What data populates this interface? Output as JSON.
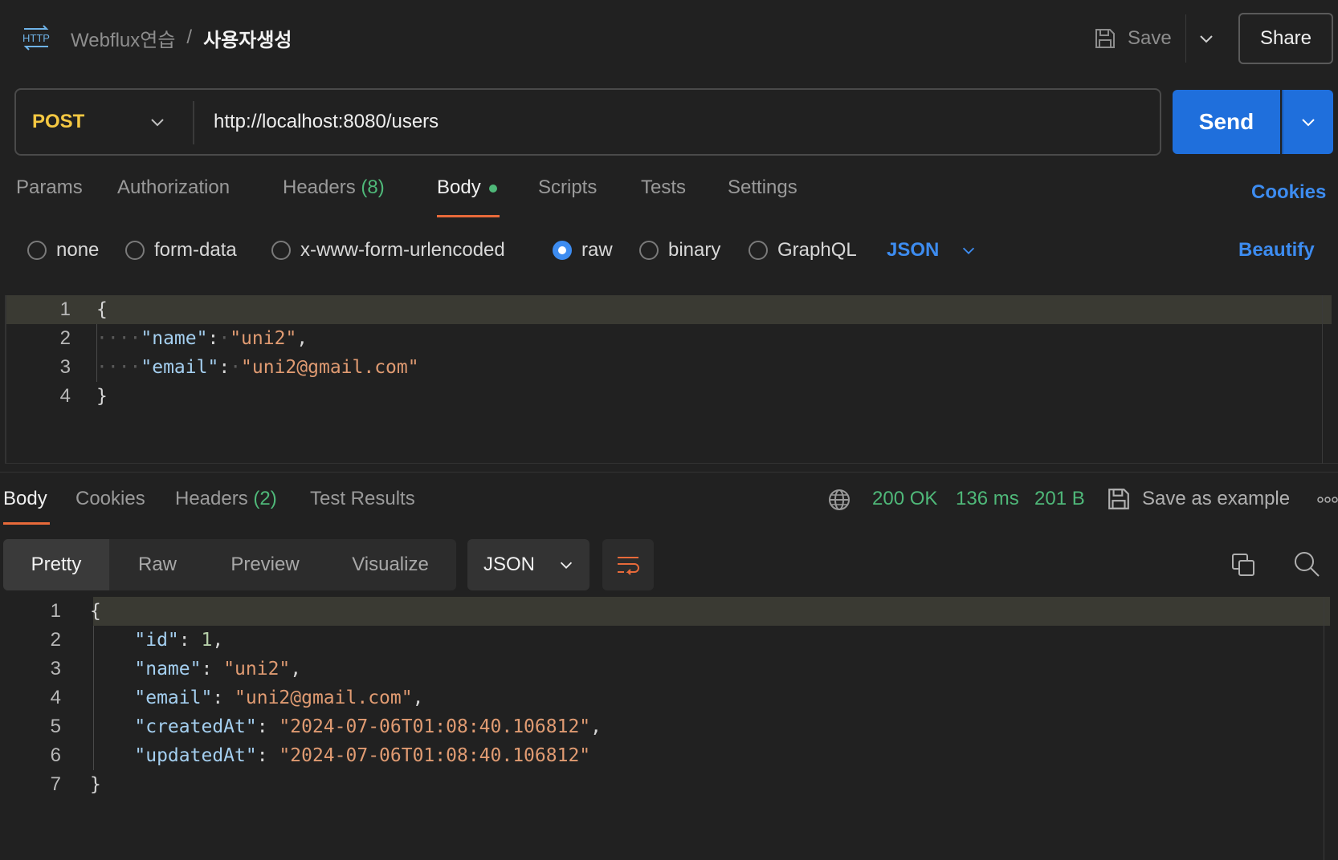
{
  "header": {
    "http_label": "HTTP",
    "collection": "Webflux연습",
    "separator": "/",
    "request_name": "사용자생성",
    "save_label": "Save",
    "share_label": "Share"
  },
  "request": {
    "method": "POST",
    "url": "http://localhost:8080/users",
    "send_label": "Send",
    "tabs": [
      {
        "label": "Params"
      },
      {
        "label": "Authorization"
      },
      {
        "label": "Headers",
        "count": "(8)"
      },
      {
        "label": "Body",
        "active": true,
        "modified": true
      },
      {
        "label": "Scripts"
      },
      {
        "label": "Tests"
      },
      {
        "label": "Settings"
      }
    ],
    "cookies_label": "Cookies",
    "body_types": [
      "none",
      "form-data",
      "x-www-form-urlencoded",
      "raw",
      "binary",
      "GraphQL"
    ],
    "selected_body_type": "raw",
    "language": "JSON",
    "beautify_label": "Beautify",
    "body_lines": [
      {
        "no": "1",
        "text": "{"
      },
      {
        "no": "2",
        "key": "\"name\"",
        "value": "\"uni2\"",
        "trail": ","
      },
      {
        "no": "3",
        "key": "\"email\"",
        "value": "\"uni2@gmail.com\"",
        "trail": ""
      },
      {
        "no": "4",
        "text": "}"
      }
    ]
  },
  "response": {
    "tabs": [
      {
        "label": "Body",
        "active": true
      },
      {
        "label": "Cookies"
      },
      {
        "label": "Headers",
        "count": "(2)"
      },
      {
        "label": "Test Results"
      }
    ],
    "status": "200 OK",
    "time": "136 ms",
    "size": "201 B",
    "save_example_label": "Save as example",
    "views": [
      "Pretty",
      "Raw",
      "Preview",
      "Visualize"
    ],
    "active_view": "Pretty",
    "format": "JSON",
    "lines": [
      {
        "no": "1",
        "text": "{"
      },
      {
        "no": "2",
        "key": "\"id\"",
        "value": "1",
        "kind": "num",
        "trail": ","
      },
      {
        "no": "3",
        "key": "\"name\"",
        "value": "\"uni2\"",
        "kind": "str",
        "trail": ","
      },
      {
        "no": "4",
        "key": "\"email\"",
        "value": "\"uni2@gmail.com\"",
        "kind": "str",
        "trail": ","
      },
      {
        "no": "5",
        "key": "\"createdAt\"",
        "value": "\"2024-07-06T01:08:40.106812\"",
        "kind": "str",
        "trail": ","
      },
      {
        "no": "6",
        "key": "\"updatedAt\"",
        "value": "\"2024-07-06T01:08:40.106812\"",
        "kind": "str",
        "trail": ""
      },
      {
        "no": "7",
        "text": "}"
      }
    ]
  },
  "colors": {
    "method": "#f5c842",
    "accent": "#3d8cf0",
    "send": "#1f6fdc",
    "success": "#4fb879",
    "tab_underline": "#e86a3a",
    "json_key": "#a4cff0",
    "json_string": "#e09b72"
  },
  "icons": [
    "http-icon",
    "save-icon",
    "chevron-down-icon",
    "globe-icon",
    "save-example-icon",
    "more-icon",
    "wrap-icon",
    "copy-icon",
    "search-icon"
  ]
}
